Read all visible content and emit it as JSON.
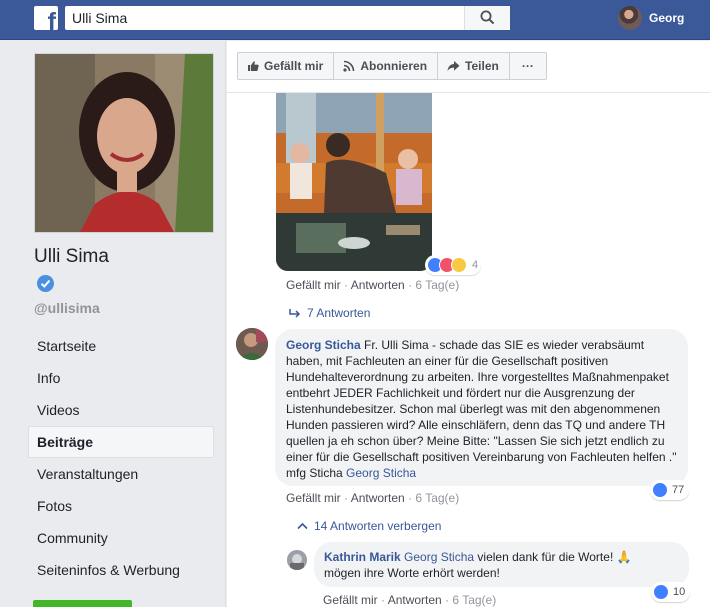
{
  "topbar": {
    "search_value": "Ulli Sima",
    "user_name": "Georg"
  },
  "profile": {
    "name": "Ulli Sima",
    "handle": "@ullisima"
  },
  "nav": {
    "items": [
      "Startseite",
      "Info",
      "Videos",
      "Beiträge",
      "Veranstaltungen",
      "Fotos",
      "Community",
      "Seiteninfos & Werbung"
    ],
    "active": "Beiträge"
  },
  "actions": {
    "like": "Gefällt mir",
    "subscribe": "Abonnieren",
    "share": "Teilen",
    "more": "···"
  },
  "post": {
    "reaction_count": "4",
    "like_label": "Gefällt mir",
    "reply_label": "Antworten",
    "time": "6 Tag(e)",
    "replies_link": "7 Antworten"
  },
  "comment": {
    "author": "Georg Sticha",
    "text": "Fr. Ulli Sima - schade das SIE es wieder verabsäumt haben, mit Fachleuten an einer für die Gesellschaft positiven Hundehalteverordnung zu arbeiten. Ihre vorgestelltes Maßnahmenpaket entbehrt JEDER Fachlichkeit und fördert nur die Ausgrenzung der Listenhundebesitzer. Schon mal überlegt was mit den abgenommenen Hunden passieren wird? Alle einschläfern, denn das TQ und andere TH quellen ja eh schon über? Meine Bitte: \"Lassen Sie sich jetzt endlich zu einer für die Gesellschaft positiven Vereinbarung von Fachleuten helfen .\" mfg Sticha",
    "tag": "Georg Sticha",
    "likes": "77",
    "like_label": "Gefällt mir",
    "reply_label": "Antworten",
    "time": "6 Tag(e)",
    "hide_replies": "14 Antworten verbergen"
  },
  "reply": {
    "author": "Kathrin Marik",
    "tag": "Georg Sticha",
    "text": "vielen dank für die Worte!",
    "emoji": "🙏",
    "text2": "mögen ihre Worte erhört werden!",
    "likes": "10",
    "like_label": "Gefällt mir",
    "reply_label": "Antworten",
    "time": "6 Tag(e)"
  },
  "colors": {
    "brand": "#3b5998",
    "link": "#385898",
    "like_blue": "#4080ff",
    "green": "#42b72a"
  }
}
